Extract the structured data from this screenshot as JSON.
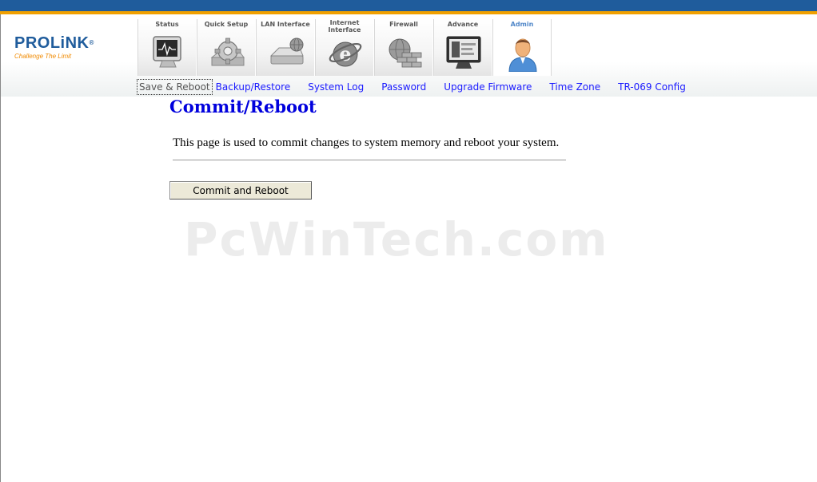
{
  "brand": {
    "name": "PROLiNK",
    "registered_mark": "®",
    "tagline": "Challenge The Limit"
  },
  "main_nav": [
    {
      "label": "Status",
      "icon": "monitor-icon",
      "active": false
    },
    {
      "label": "Quick Setup",
      "icon": "gear-icon",
      "active": false
    },
    {
      "label": "LAN Interface",
      "icon": "network-drive-icon",
      "active": false
    },
    {
      "label": "Internet Interface",
      "icon": "internet-explorer-icon",
      "active": false
    },
    {
      "label": "Firewall",
      "icon": "firewall-icon",
      "active": false
    },
    {
      "label": "Advance",
      "icon": "advanced-settings-icon",
      "active": false
    },
    {
      "label": "Admin",
      "icon": "admin-user-icon",
      "active": true
    }
  ],
  "sub_nav": [
    {
      "label": "Save & Reboot",
      "current": true
    },
    {
      "label": "Backup/Restore",
      "current": false
    },
    {
      "label": "System Log",
      "current": false
    },
    {
      "label": "Password",
      "current": false
    },
    {
      "label": "Upgrade Firmware",
      "current": false
    },
    {
      "label": "Time Zone",
      "current": false
    },
    {
      "label": "TR-069 Config",
      "current": false
    }
  ],
  "content": {
    "title": "Commit/Reboot",
    "description": "This page is used to commit changes to system memory and reboot your system.",
    "button_label": "Commit and Reboot"
  },
  "watermark": "PcWinTech.com",
  "colors": {
    "header_blue": "#1f5c9c",
    "header_orange": "#f0a000",
    "title_blue": "#0000dd",
    "link_blue": "#1a1aff"
  }
}
